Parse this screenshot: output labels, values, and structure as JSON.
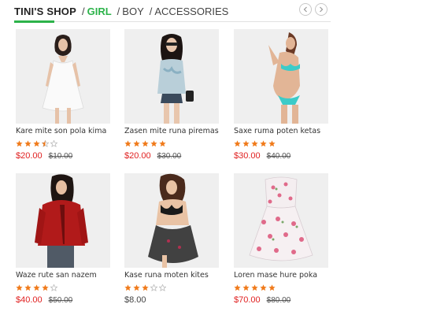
{
  "header": {
    "shop_title": "TINI'S SHOP",
    "categories": [
      {
        "label": "GIRL",
        "active": true
      },
      {
        "label": "BOY",
        "active": false
      },
      {
        "label": "ACCESSORIES",
        "active": false
      }
    ],
    "prev_icon": "chevron-left-icon",
    "next_icon": "chevron-right-icon"
  },
  "colors": {
    "accent": "#2cb34a",
    "price": "#e02020",
    "star": "#f07a1a"
  },
  "products": [
    {
      "name": "Kare mite son pola kima",
      "rating": 3.5,
      "price": "$20.00",
      "old_price": "$10.00",
      "image": "woman-white-dress"
    },
    {
      "name": "Zasen mite runa piremas",
      "rating": 5,
      "price": "$20.00",
      "old_price": "$30.00",
      "image": "woman-tie-dye-top"
    },
    {
      "name": "Saxe ruma poten ketas",
      "rating": 5,
      "price": "$30.00",
      "old_price": "$40.00",
      "image": "woman-bikini"
    },
    {
      "name": "Waze rute san nazem",
      "rating": 4,
      "price": "$40.00",
      "old_price": "$50.00",
      "image": "woman-red-jacket"
    },
    {
      "name": "Kase runa moten kites",
      "rating": 3,
      "price": "$8.00",
      "old_price": "",
      "image": "woman-black-lingerie"
    },
    {
      "name": "Loren mase hure poka",
      "rating": 5,
      "price": "$70.00",
      "old_price": "$80.00",
      "image": "floral-strapless-dress"
    }
  ]
}
